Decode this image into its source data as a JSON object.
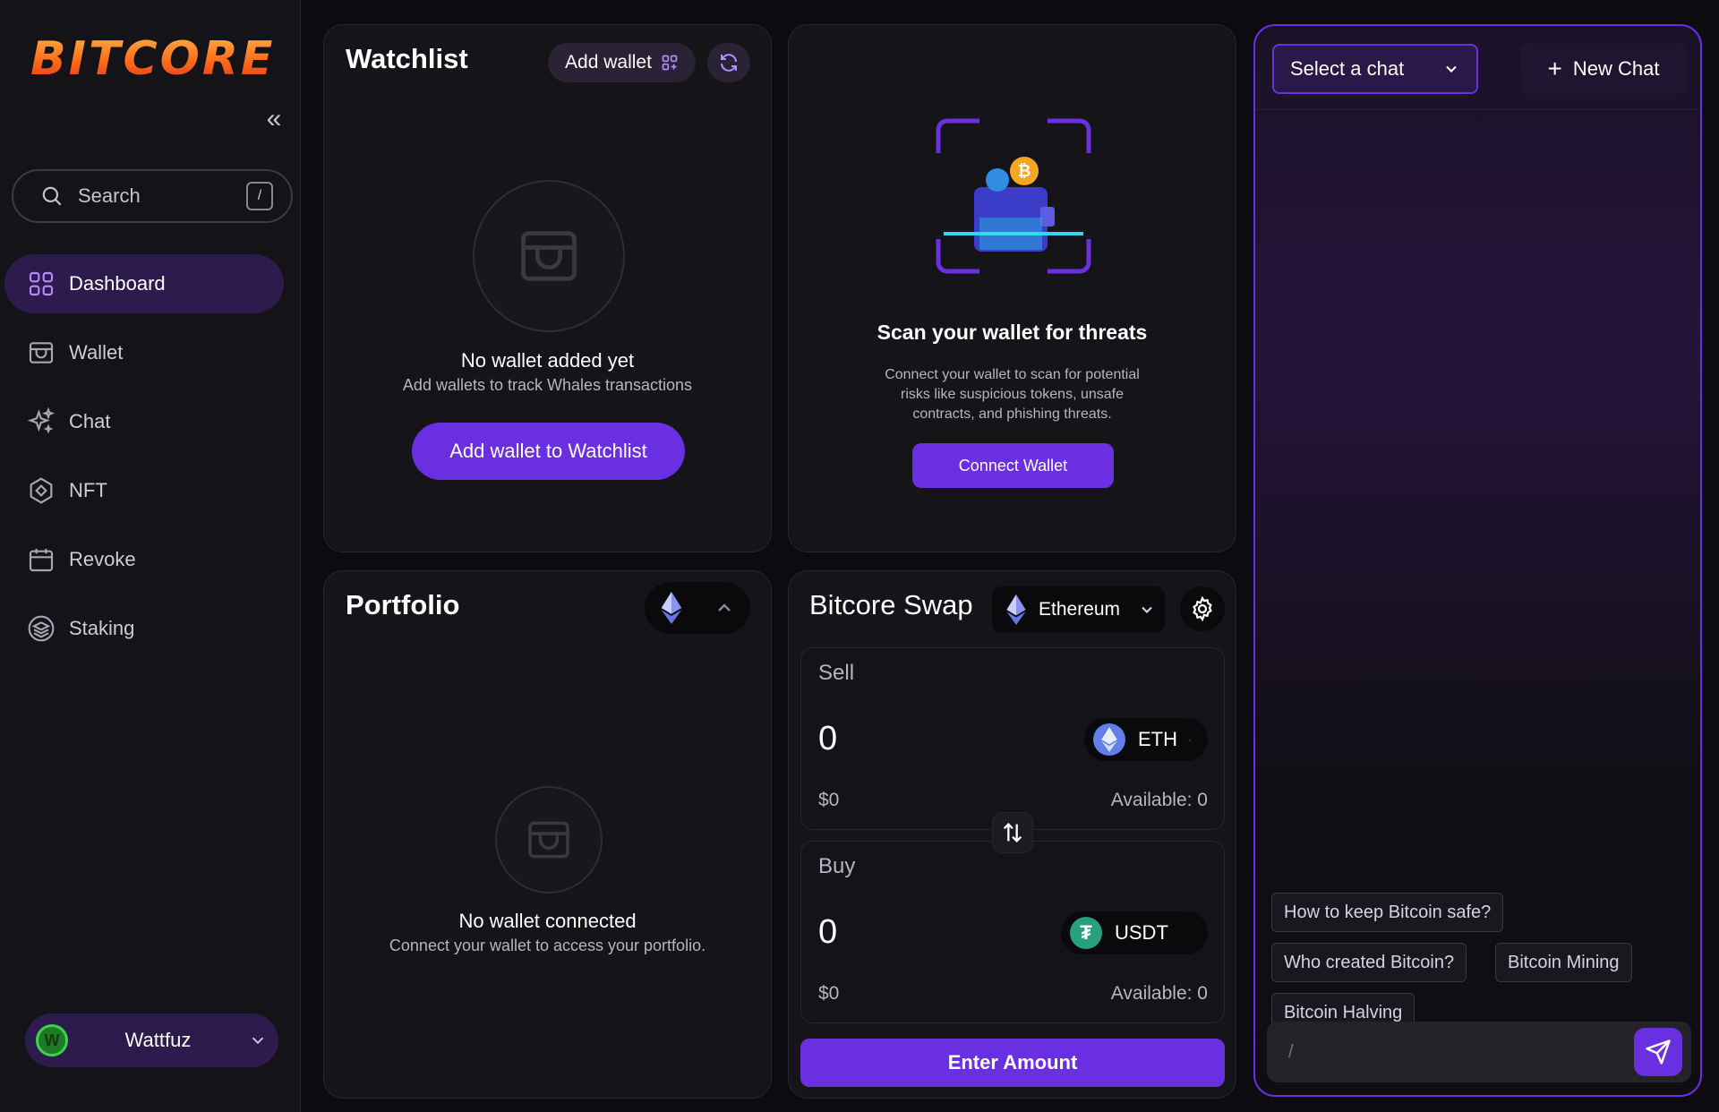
{
  "brand": {
    "logo_text": "BITCORE",
    "accent": "#6a2fe0",
    "logo_colors": [
      "#ffb347",
      "#ff6a1a",
      "#d9321c"
    ]
  },
  "sidebar": {
    "collapse_icon": "double-chevron-left-icon",
    "search": {
      "label": "Search",
      "shortcut": "/"
    },
    "items": [
      {
        "label": "Dashboard",
        "icon": "grid-icon",
        "active": true
      },
      {
        "label": "Wallet",
        "icon": "wallet-icon",
        "active": false
      },
      {
        "label": "Chat",
        "icon": "sparkles-icon",
        "active": false
      },
      {
        "label": "NFT",
        "icon": "nft-tag-icon",
        "active": false
      },
      {
        "label": "Revoke",
        "icon": "calendar-icon",
        "active": false
      },
      {
        "label": "Staking",
        "icon": "stack-coins-icon",
        "active": false
      }
    ],
    "user": {
      "name": "Wattfuz",
      "avatar_letter": "W"
    }
  },
  "watchlist": {
    "title": "Watchlist",
    "add_wallet_label": "Add wallet",
    "empty_title": "No wallet added yet",
    "empty_subtitle": "Add wallets to track Whales transactions",
    "cta_label": "Add wallet to Watchlist"
  },
  "scan": {
    "title": "Scan your wallet for threats",
    "description_line1": "Connect your wallet to scan for potential",
    "description_line2": "risks like suspicious tokens, unsafe",
    "description_line3": "contracts, and phishing threats.",
    "cta_label": "Connect Wallet"
  },
  "portfolio": {
    "title": "Portfolio",
    "empty_title": "No wallet connected",
    "empty_subtitle": "Connect your wallet to access your portfolio."
  },
  "swap": {
    "title": "Bitcore Swap",
    "network": "Ethereum",
    "sell": {
      "label": "Sell",
      "amount": "0",
      "usd": "$0",
      "available": "Available: 0",
      "token": "ETH"
    },
    "buy": {
      "label": "Buy",
      "amount": "0",
      "usd": "$0",
      "available": "Available: 0",
      "token": "USDT"
    },
    "cta_label": "Enter Amount"
  },
  "chat": {
    "select_label": "Select a chat",
    "new_chat_label": "New Chat",
    "suggestions": [
      "How to keep Bitcoin safe?",
      "Who created Bitcoin?",
      "Bitcoin Mining",
      "Bitcoin Halving"
    ],
    "input_placeholder": "/"
  }
}
